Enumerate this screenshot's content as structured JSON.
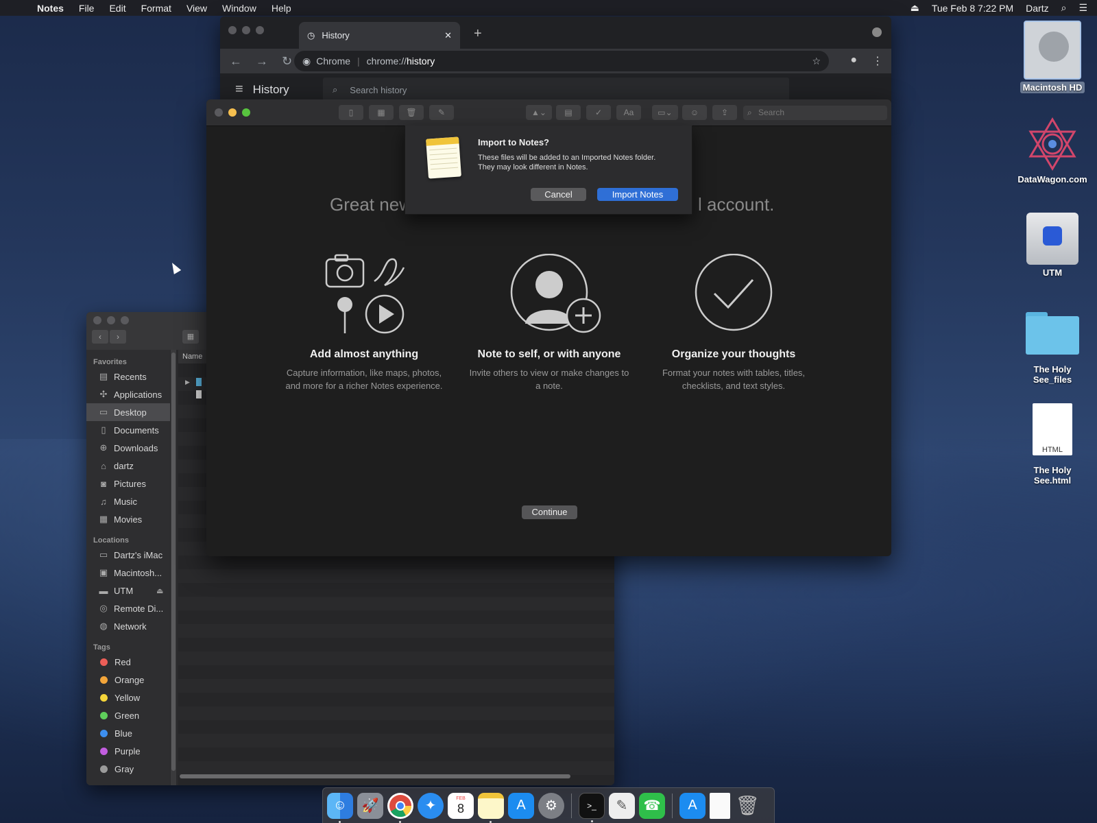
{
  "menubar": {
    "app_name": "Notes",
    "items": [
      "File",
      "Edit",
      "Format",
      "View",
      "Window",
      "Help"
    ],
    "datetime": "Tue Feb 8  7:22 PM",
    "user": "Dartz"
  },
  "desktop_icons": [
    {
      "label": "Macintosh HD"
    },
    {
      "label": "DataWagon.com"
    },
    {
      "label": "UTM"
    },
    {
      "label": "The Holy See_files"
    },
    {
      "label": "The Holy See.html",
      "badge": "HTML"
    }
  ],
  "chrome": {
    "tab_title": "History",
    "omnibox_origin": "Chrome",
    "omnibox_scheme": "chrome://",
    "omnibox_path": "history",
    "page_title": "History",
    "search_placeholder": "Search history"
  },
  "finder": {
    "favorites_header": "Favorites",
    "favorites": [
      {
        "label": "Recents",
        "icon": "clock-icon"
      },
      {
        "label": "Applications",
        "icon": "applications-icon"
      },
      {
        "label": "Desktop",
        "icon": "desktop-icon",
        "selected": true
      },
      {
        "label": "Documents",
        "icon": "document-icon"
      },
      {
        "label": "Downloads",
        "icon": "download-icon"
      },
      {
        "label": "dartz",
        "icon": "home-icon"
      },
      {
        "label": "Pictures",
        "icon": "camera-icon"
      },
      {
        "label": "Music",
        "icon": "music-icon"
      },
      {
        "label": "Movies",
        "icon": "film-icon"
      }
    ],
    "locations_header": "Locations",
    "locations": [
      {
        "label": "Dartz's iMac",
        "icon": "imac-icon"
      },
      {
        "label": "Macintosh...",
        "icon": "disk-icon"
      },
      {
        "label": "UTM",
        "icon": "disk-icon"
      },
      {
        "label": "Remote Di...",
        "icon": "remote-disc-icon"
      },
      {
        "label": "Network",
        "icon": "globe-icon"
      }
    ],
    "tags_header": "Tags",
    "tags": [
      {
        "label": "Red",
        "color": "#ec5e57"
      },
      {
        "label": "Orange",
        "color": "#f3a53a"
      },
      {
        "label": "Yellow",
        "color": "#f5d53a"
      },
      {
        "label": "Green",
        "color": "#5fcf5b"
      },
      {
        "label": "Blue",
        "color": "#3d8ff0"
      },
      {
        "label": "Purple",
        "color": "#c35ee0"
      },
      {
        "label": "Gray",
        "color": "#9b9b9b"
      }
    ],
    "column_header": "Name"
  },
  "notes": {
    "headline_left": "Great new",
    "headline_right": "l account.",
    "features": [
      {
        "title": "Add almost anything",
        "desc": "Capture information, like maps, photos, and more for a richer Notes experience."
      },
      {
        "title": "Note to self, or with anyone",
        "desc": "Invite others to view or make changes to a note."
      },
      {
        "title": "Organize your thoughts",
        "desc": "Format your notes with tables, titles, checklists, and text styles."
      }
    ],
    "continue_label": "Continue",
    "search_placeholder": "Search",
    "toolbar_format_label": "Aa"
  },
  "dialog": {
    "title": "Import to Notes?",
    "message_line1": "These files will be added to an Imported Notes folder.",
    "message_line2": "They may look different in Notes.",
    "cancel_label": "Cancel",
    "confirm_label": "Import Notes"
  },
  "dock": {
    "apps": [
      "finder-icon",
      "launchpad-icon",
      "chrome-icon",
      "safari-icon",
      "calendar-icon",
      "notes-icon",
      "app-store-icon",
      "system-preferences-icon",
      "terminal-icon",
      "textedit-icon",
      "facetime-icon",
      "app-store-icon",
      "document-icon",
      "trash-icon"
    ],
    "calendar_month": "FEB",
    "calendar_day": "8"
  }
}
